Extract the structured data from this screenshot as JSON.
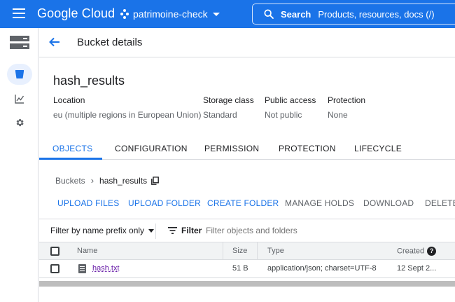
{
  "app": {
    "brand": "Google Cloud",
    "project": "patrimoine-check",
    "search_label": "Search",
    "search_placeholder": "Products, resources, docs (/)"
  },
  "page": {
    "title": "Bucket details",
    "bucket_name": "hash_results"
  },
  "meta": {
    "location_label": "Location",
    "location_value": "eu (multiple regions in European Union)",
    "storage_class_label": "Storage class",
    "storage_class_value": "Standard",
    "public_access_label": "Public access",
    "public_access_value": "Not public",
    "protection_label": "Protection",
    "protection_value": "None"
  },
  "tabs": [
    {
      "label": "OBJECTS",
      "active": true
    },
    {
      "label": "CONFIGURATION",
      "active": false
    },
    {
      "label": "PERMISSION",
      "active": false
    },
    {
      "label": "PROTECTION",
      "active": false
    },
    {
      "label": "LIFECYCLE",
      "active": false
    }
  ],
  "breadcrumb": {
    "root": "Buckets",
    "separator": "›",
    "current": "hash_results"
  },
  "actions": {
    "upload_files": "UPLOAD FILES",
    "upload_folder": "UPLOAD FOLDER",
    "create_folder": "CREATE FOLDER",
    "manage_holds": "MANAGE HOLDS",
    "download": "DOWNLOAD",
    "delete": "DELETE"
  },
  "filter": {
    "prefix_mode": "Filter by name prefix only",
    "filter_label": "Filter",
    "placeholder": "Filter objects and folders"
  },
  "table": {
    "columns": {
      "name": "Name",
      "size": "Size",
      "type": "Type",
      "created": "Created"
    },
    "rows": [
      {
        "name": "hash.txt",
        "size": "51 B",
        "type": "application/json; charset=UTF-8",
        "created": "12 Sept 2..."
      }
    ]
  },
  "colors": {
    "brand_blue": "#1a73e8",
    "link_purple": "#681da8"
  }
}
